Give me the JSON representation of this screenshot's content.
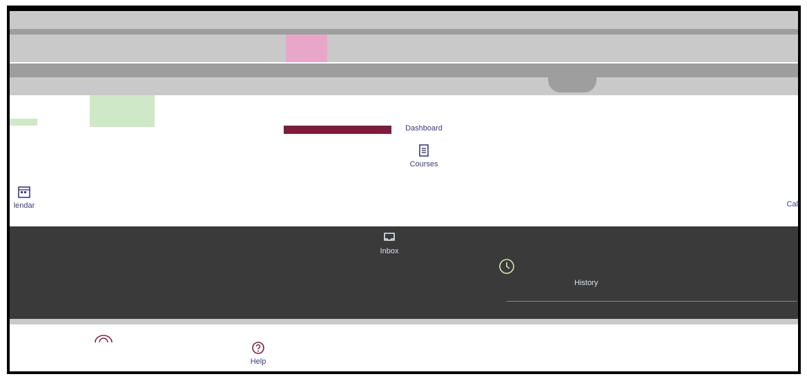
{
  "nav": {
    "dashboard": "Dashboard",
    "courses": "Courses",
    "calendar": "lendar",
    "calendar_right": "Cal",
    "inbox": "Inbox",
    "history": "History",
    "help": "Help"
  },
  "icons": {
    "courses": "book-icon",
    "calendar": "calendar-icon",
    "inbox": "inbox-icon",
    "history": "clock-icon",
    "help": "help-icon"
  },
  "colors": {
    "primary_text": "#3a3a7a",
    "dark_panel": "#3a3a3a",
    "accent_green": "#cfe8c7",
    "accent_maroon": "#7a1d3b",
    "accent_pink": "#e8a7c8",
    "history_icon": "#d6e6b5"
  }
}
